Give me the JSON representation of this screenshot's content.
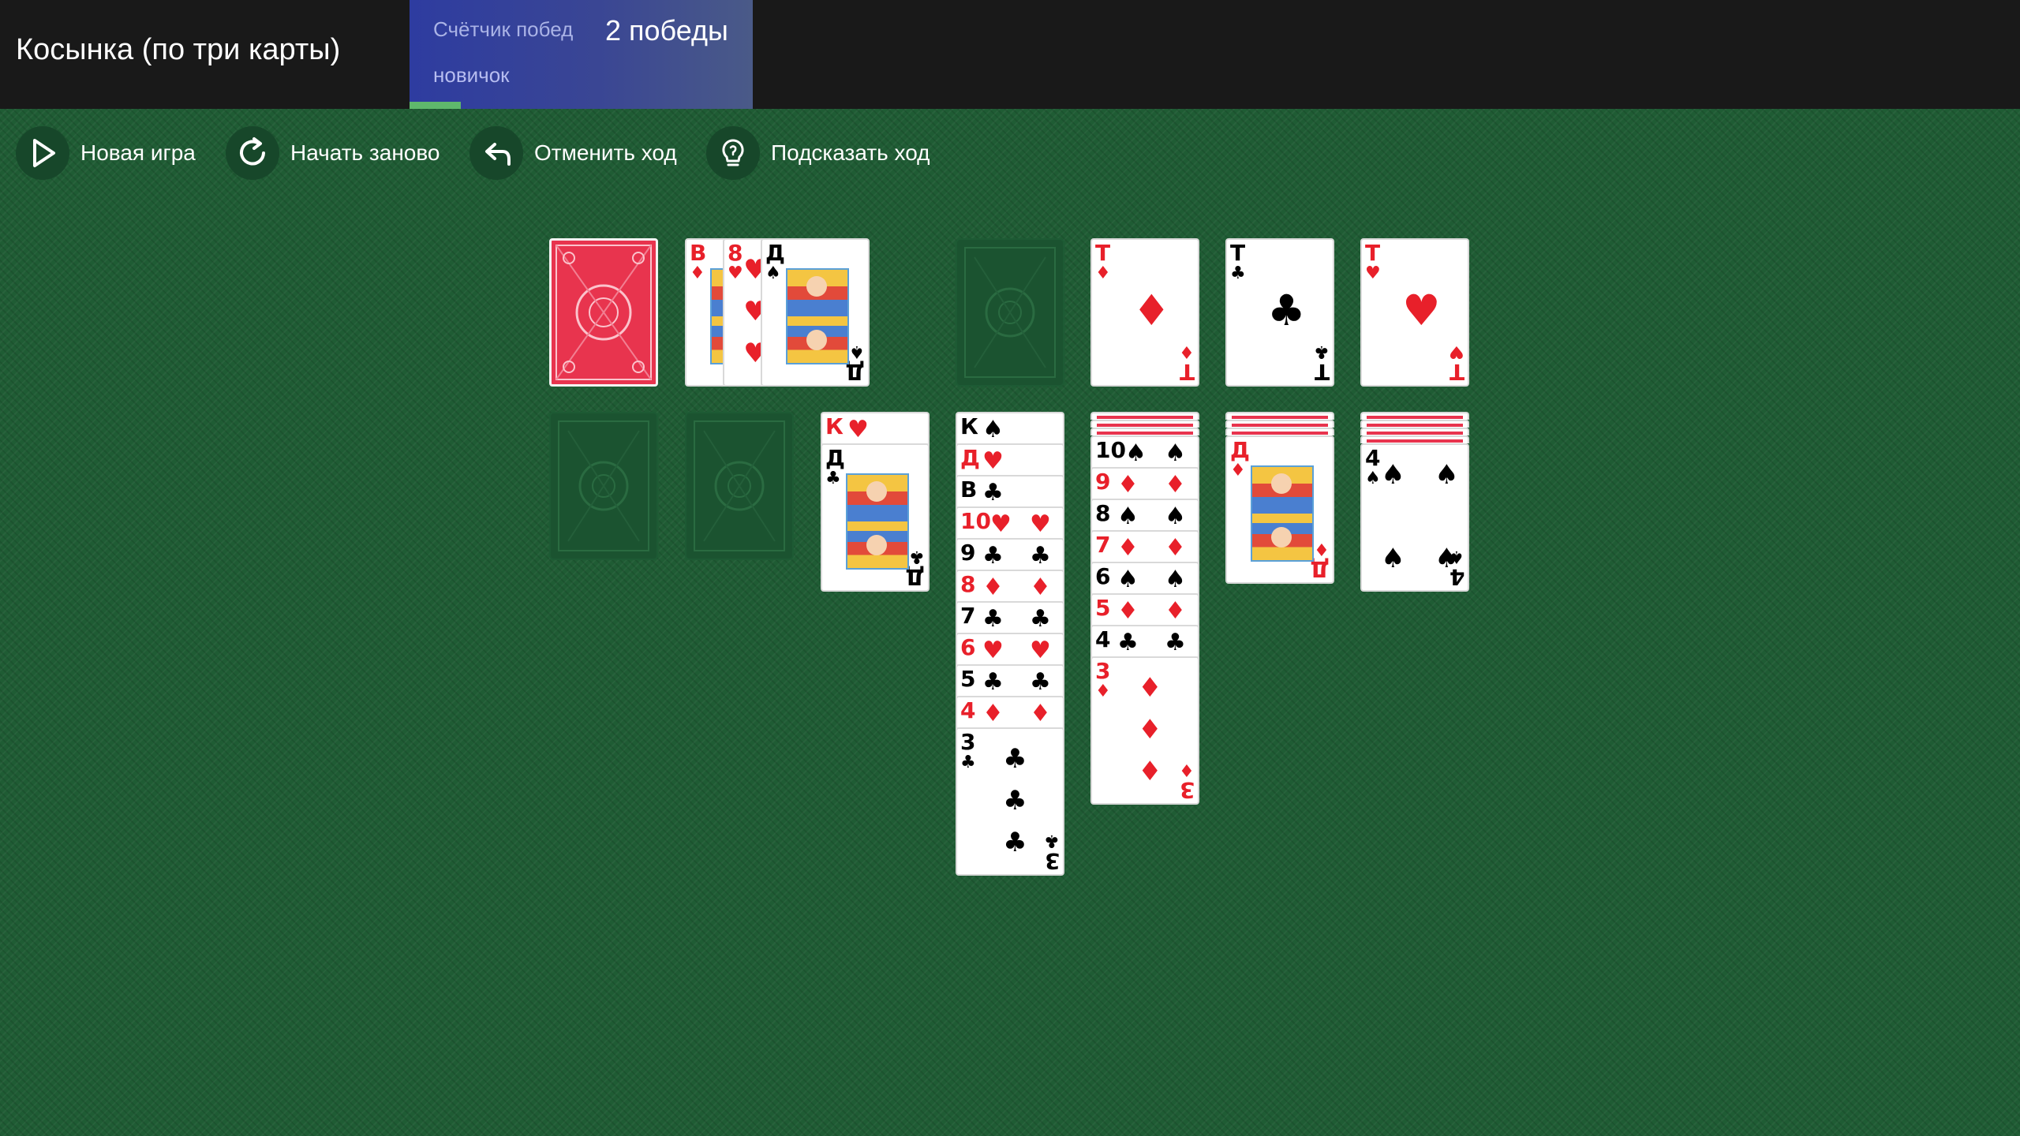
{
  "header": {
    "title": "Косынка (по три карты)",
    "counter_label": "Счётчик побед",
    "counter_value": "2 победы",
    "rank": "новичок",
    "progress": 0.15
  },
  "toolbar": {
    "new_game": "Новая игра",
    "restart": "Начать заново",
    "undo": "Отменить ход",
    "hint": "Подсказать ход"
  },
  "colors": {
    "table": "#1f5c34",
    "header": "#191919",
    "card_back": "#e8344e",
    "red_suit": "#e8202a"
  },
  "stock": {
    "face_down": true
  },
  "waste": [
    {
      "rank": "В",
      "suit": "♦"
    },
    {
      "rank": "8",
      "suit": "♥"
    },
    {
      "rank": "Д",
      "suit": "♠"
    }
  ],
  "foundations": [
    {
      "empty": true
    },
    {
      "rank": "Т",
      "suit": "♦"
    },
    {
      "rank": "Т",
      "suit": "♣"
    },
    {
      "rank": "Т",
      "suit": "♥"
    }
  ],
  "tableau": [
    {
      "hidden": 0,
      "cards": []
    },
    {
      "hidden": 0,
      "cards": []
    },
    {
      "hidden": 0,
      "cards": [
        {
          "rank": "К",
          "suit": "♥"
        },
        {
          "rank": "Д",
          "suit": "♣"
        }
      ]
    },
    {
      "hidden": 0,
      "cards": [
        {
          "rank": "К",
          "suit": "♠"
        },
        {
          "rank": "Д",
          "suit": "♥"
        },
        {
          "rank": "В",
          "suit": "♣"
        },
        {
          "rank": "10",
          "suit": "♥"
        },
        {
          "rank": "9",
          "suit": "♣"
        },
        {
          "rank": "8",
          "suit": "♦"
        },
        {
          "rank": "7",
          "suit": "♣"
        },
        {
          "rank": "6",
          "suit": "♥"
        },
        {
          "rank": "5",
          "suit": "♣"
        },
        {
          "rank": "4",
          "suit": "♦"
        },
        {
          "rank": "3",
          "suit": "♣"
        }
      ]
    },
    {
      "hidden": 3,
      "cards": [
        {
          "rank": "10",
          "suit": "♠"
        },
        {
          "rank": "9",
          "suit": "♦"
        },
        {
          "rank": "8",
          "suit": "♠"
        },
        {
          "rank": "7",
          "suit": "♦"
        },
        {
          "rank": "6",
          "suit": "♠"
        },
        {
          "rank": "5",
          "suit": "♦"
        },
        {
          "rank": "4",
          "suit": "♣"
        },
        {
          "rank": "3",
          "suit": "♦"
        }
      ]
    },
    {
      "hidden": 3,
      "cards": [
        {
          "rank": "Д",
          "suit": "♦"
        }
      ]
    },
    {
      "hidden": 4,
      "cards": [
        {
          "rank": "4",
          "suit": "♠"
        }
      ]
    }
  ]
}
